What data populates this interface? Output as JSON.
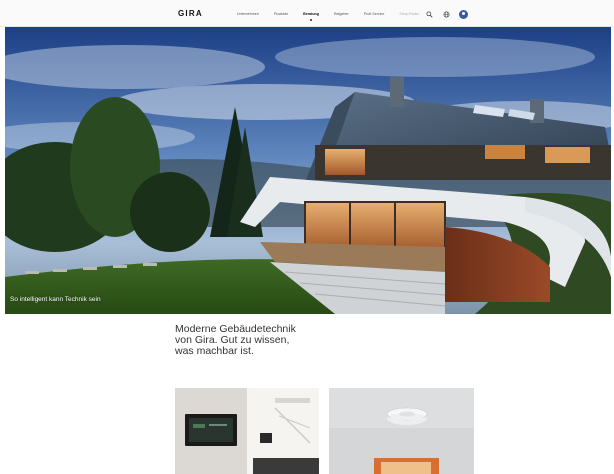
{
  "header": {
    "logo": "GIRA",
    "nav": [
      {
        "label": "Unternehmen",
        "active": false
      },
      {
        "label": "Produkte",
        "active": false
      },
      {
        "label": "Beratung",
        "active": true
      },
      {
        "label": "Ratgeber",
        "active": false
      },
      {
        "label": "Profi-Service",
        "active": false
      },
      {
        "label": "Shop-Finder",
        "active": false,
        "muted": true
      }
    ],
    "icons": [
      "search-icon",
      "globe-icon",
      "account-icon"
    ]
  },
  "hero": {
    "caption": "So intelligent kann Technik sein"
  },
  "intro": {
    "lines": [
      "Moderne Gebäudetechnik",
      "von Gira. Gut zu wissen,",
      "was machbar ist."
    ]
  },
  "cards": [
    {
      "name": "interior-control-panel"
    },
    {
      "name": "smoke-detector"
    }
  ]
}
